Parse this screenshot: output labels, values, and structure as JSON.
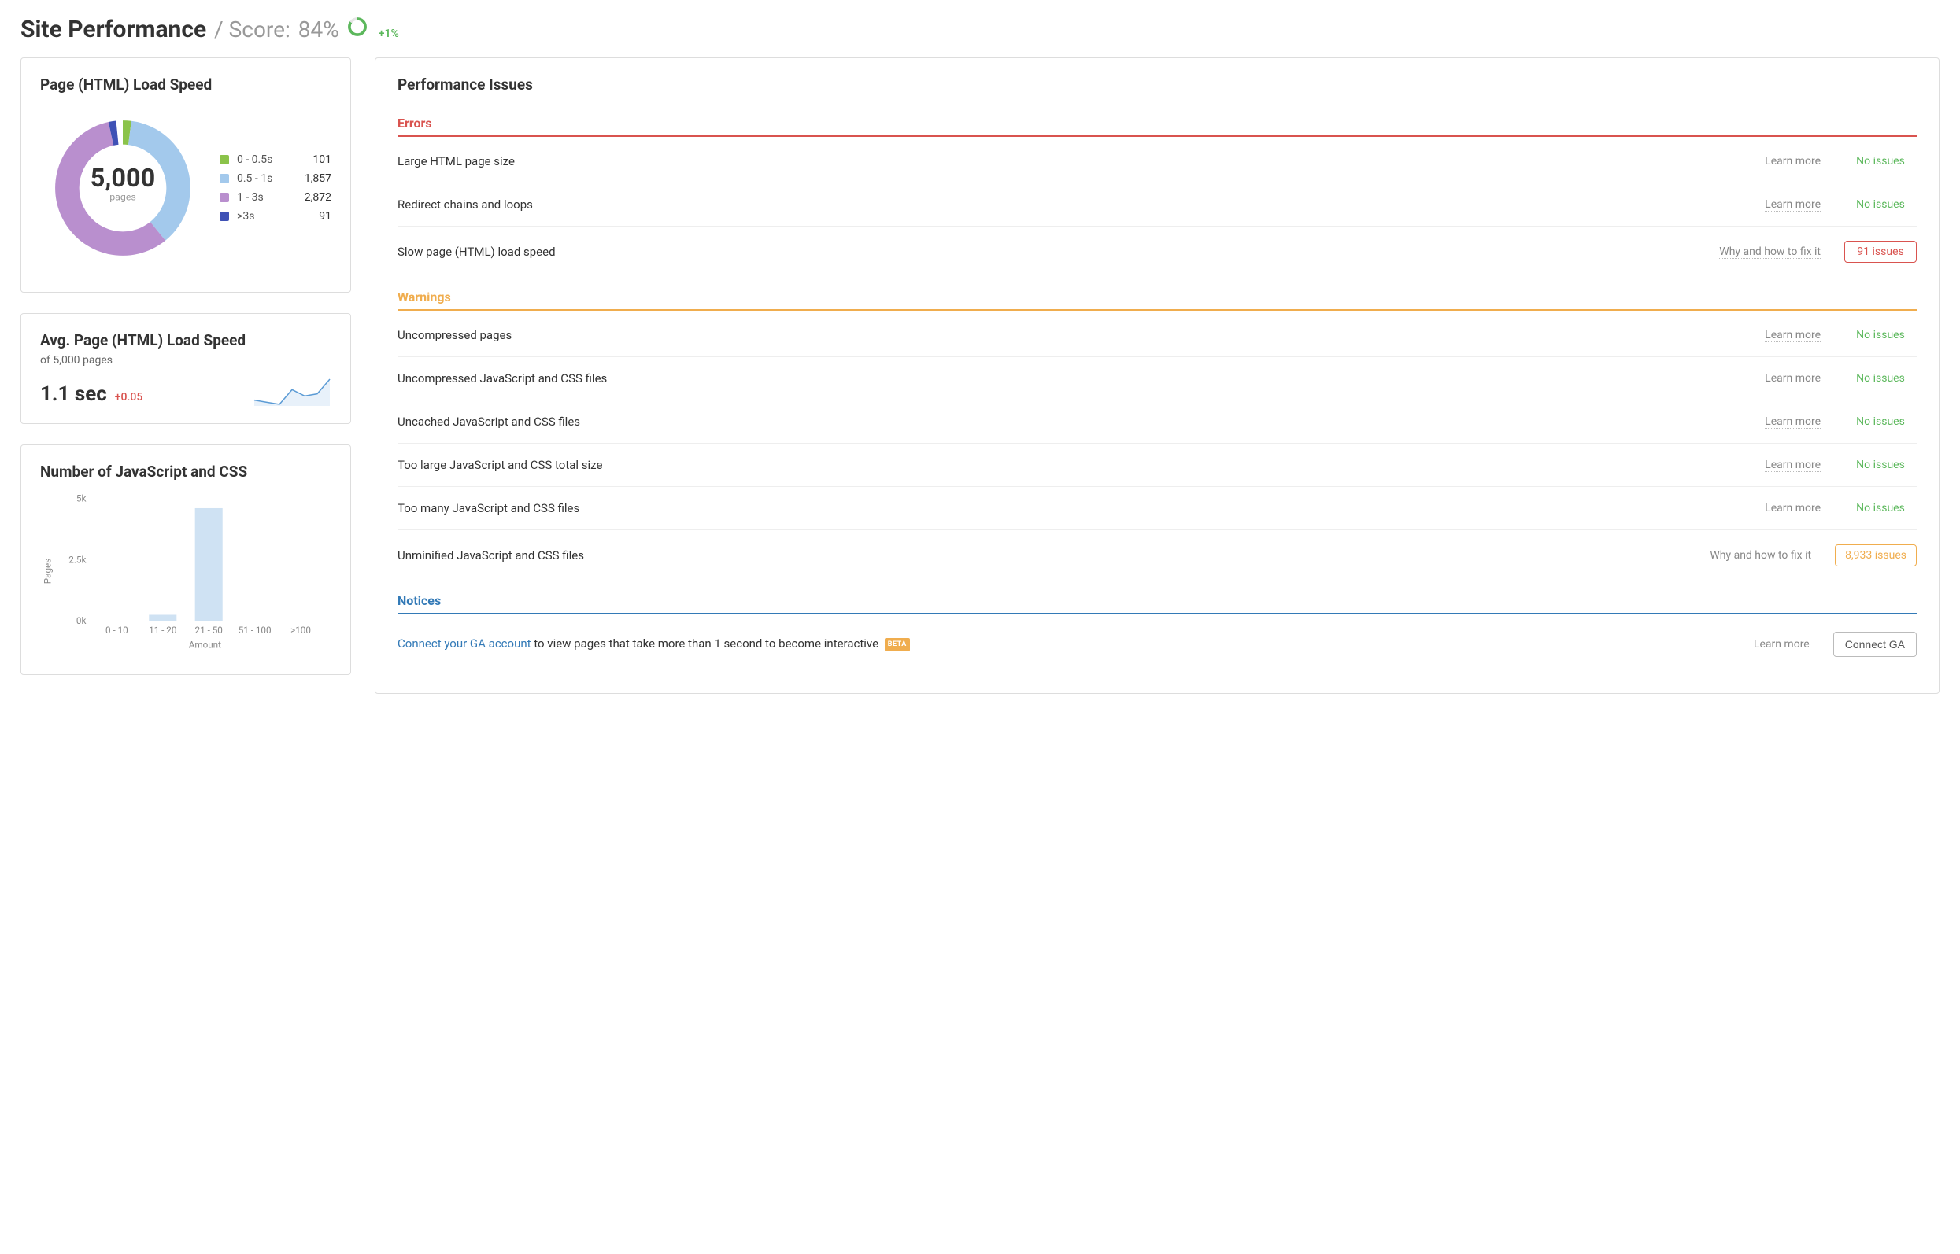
{
  "header": {
    "title": "Site Performance",
    "score_prefix": "/ Score:",
    "score_value": "84%",
    "score_delta": "+1%",
    "gauge_percent": 84
  },
  "load_speed_card": {
    "title": "Page (HTML) Load Speed",
    "center_value": "5,000",
    "center_label": "pages",
    "legend": [
      {
        "label": "0 - 0.5s",
        "value": "101",
        "color": "#8bc34a",
        "pct": 2.02
      },
      {
        "label": "0.5 - 1s",
        "value": "1,857",
        "color": "#a3c9ec",
        "pct": 37.14
      },
      {
        "label": "1 - 3s",
        "value": "2,872",
        "color": "#b98fce",
        "pct": 57.44
      },
      {
        "label": ">3s",
        "value": "91",
        "color": "#3f51b5",
        "pct": 1.82
      }
    ]
  },
  "avg_card": {
    "title": "Avg. Page (HTML) Load Speed",
    "subtitle": "of 5,000 pages",
    "value": "1.1 sec",
    "delta": "+0.05"
  },
  "jscss_card": {
    "title": "Number of JavaScript and CSS",
    "ylabel": "Pages",
    "xlabel": "Amount"
  },
  "chart_data": [
    {
      "id": "donut_load_speed",
      "type": "pie",
      "title": "Page (HTML) Load Speed",
      "categories": [
        "0 - 0.5s",
        "0.5 - 1s",
        "1 - 3s",
        ">3s"
      ],
      "values": [
        101,
        1857,
        2872,
        91
      ],
      "total_label": "5,000 pages"
    },
    {
      "id": "sparkline_avg_load",
      "type": "line",
      "title": "Avg. Page (HTML) Load Speed trend",
      "x": [
        1,
        2,
        3,
        4,
        5,
        6,
        7
      ],
      "values": [
        1.05,
        1.04,
        1.03,
        1.1,
        1.07,
        1.08,
        1.15
      ],
      "ylabel": "sec"
    },
    {
      "id": "bar_js_css",
      "type": "bar",
      "title": "Number of JavaScript and CSS",
      "xlabel": "Amount",
      "ylabel": "Pages",
      "categories": [
        "0 - 10",
        "11 - 20",
        "21 - 50",
        "51 - 100",
        ">100"
      ],
      "values": [
        0,
        250,
        4600,
        0,
        0
      ],
      "ylim": [
        0,
        5000
      ],
      "yticks": [
        0,
        2500,
        5000
      ],
      "ytick_labels": [
        "0k",
        "2.5k",
        "5k"
      ]
    }
  ],
  "issues": {
    "title": "Performance Issues",
    "learn_more": "Learn more",
    "how_to_fix": "Why and how to fix it",
    "no_issues": "No issues",
    "sections": {
      "errors": {
        "heading": "Errors",
        "items": [
          {
            "name": "Large HTML page size",
            "status": "ok",
            "link": "learn"
          },
          {
            "name": "Redirect chains and loops",
            "status": "ok",
            "link": "learn"
          },
          {
            "name": "Slow page (HTML) load speed",
            "status": "count",
            "count": "91 issues",
            "severity": "error",
            "link": "fix"
          }
        ]
      },
      "warnings": {
        "heading": "Warnings",
        "items": [
          {
            "name": "Uncompressed pages",
            "status": "ok",
            "link": "learn"
          },
          {
            "name": "Uncompressed JavaScript and CSS files",
            "status": "ok",
            "link": "learn"
          },
          {
            "name": "Uncached JavaScript and CSS files",
            "status": "ok",
            "link": "learn"
          },
          {
            "name": "Too large JavaScript and CSS total size",
            "status": "ok",
            "link": "learn"
          },
          {
            "name": "Too many JavaScript and CSS files",
            "status": "ok",
            "link": "learn"
          },
          {
            "name": "Unminified JavaScript and CSS files",
            "status": "count",
            "count": "8,933 issues",
            "severity": "warning",
            "link": "fix"
          }
        ]
      },
      "notices": {
        "heading": "Notices",
        "connect_link": "Connect your GA account",
        "connect_rest": " to view pages that take more than 1 second to become interactive ",
        "beta": "BETA",
        "connect_button": "Connect GA"
      }
    }
  }
}
